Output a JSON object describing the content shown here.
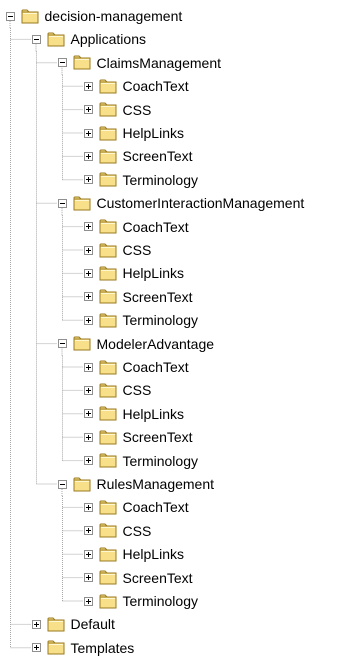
{
  "colors": {
    "folder_fill": "#f8e08b",
    "folder_stroke": "#9a7a1f",
    "line": "#a8a8a8"
  },
  "icons": {
    "folder": "folder-icon",
    "expand": "plus-icon",
    "collapse": "minus-icon"
  },
  "tree": [
    {
      "label": "decision-management",
      "expanded": true,
      "children": [
        {
          "label": "Applications",
          "expanded": true,
          "children": [
            {
              "label": "ClaimsManagement",
              "expanded": true,
              "children": [
                {
                  "label": "CoachText",
                  "expanded": false
                },
                {
                  "label": "CSS",
                  "expanded": false
                },
                {
                  "label": "HelpLinks",
                  "expanded": false
                },
                {
                  "label": "ScreenText",
                  "expanded": false
                },
                {
                  "label": "Terminology",
                  "expanded": false
                }
              ]
            },
            {
              "label": "CustomerInteractionManagement",
              "expanded": true,
              "children": [
                {
                  "label": "CoachText",
                  "expanded": false
                },
                {
                  "label": "CSS",
                  "expanded": false
                },
                {
                  "label": "HelpLinks",
                  "expanded": false
                },
                {
                  "label": "ScreenText",
                  "expanded": false
                },
                {
                  "label": "Terminology",
                  "expanded": false
                }
              ]
            },
            {
              "label": "ModelerAdvantage",
              "expanded": true,
              "children": [
                {
                  "label": "CoachText",
                  "expanded": false
                },
                {
                  "label": "CSS",
                  "expanded": false
                },
                {
                  "label": "HelpLinks",
                  "expanded": false
                },
                {
                  "label": "ScreenText",
                  "expanded": false
                },
                {
                  "label": "Terminology",
                  "expanded": false
                }
              ]
            },
            {
              "label": "RulesManagement",
              "expanded": true,
              "children": [
                {
                  "label": "CoachText",
                  "expanded": false
                },
                {
                  "label": "CSS",
                  "expanded": false
                },
                {
                  "label": "HelpLinks",
                  "expanded": false
                },
                {
                  "label": "ScreenText",
                  "expanded": false
                },
                {
                  "label": "Terminology",
                  "expanded": false
                }
              ]
            }
          ]
        },
        {
          "label": "Default",
          "expanded": false
        },
        {
          "label": "Templates",
          "expanded": false
        }
      ]
    }
  ]
}
